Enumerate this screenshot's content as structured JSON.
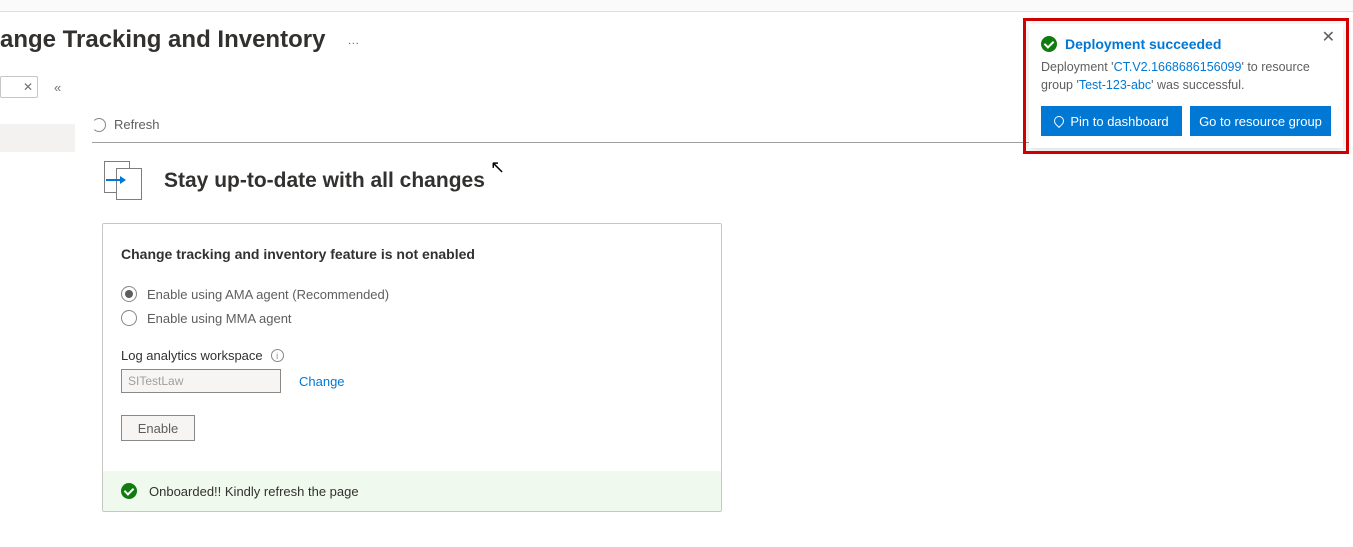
{
  "page": {
    "title": "ange Tracking and Inventory",
    "more_dots": "…"
  },
  "toolbar": {
    "refresh_label": "Refresh"
  },
  "headline": "Stay up-to-date with all changes",
  "card": {
    "title": "Change tracking and inventory feature is not enabled",
    "radio_ama": "Enable using AMA agent (Recommended)",
    "radio_mma": "Enable using MMA agent",
    "workspace_label": "Log analytics workspace",
    "workspace_value": "SITestLaw",
    "change_link": "Change",
    "enable_button": "Enable",
    "status_msg": "Onboarded!! Kindly refresh the page"
  },
  "toast": {
    "title": "Deployment succeeded",
    "msg_prefix": "Deployment '",
    "deployment_name": "CT.V2.1668686156099",
    "msg_mid": "' to resource group '",
    "resource_group": "Test-123-abc",
    "msg_suffix": "' was successful.",
    "pin_label": "Pin to dashboard",
    "goto_label": "Go to resource group"
  }
}
